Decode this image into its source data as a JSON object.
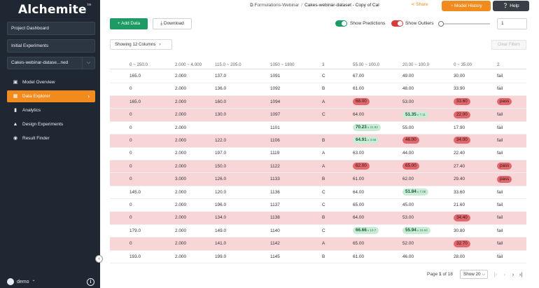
{
  "sidebar": {
    "logo": "Alchemite",
    "logo_mark": "tm",
    "project_dashboard": "Project Dashboard",
    "initial_experiments": "Initial Experiments",
    "dataset_select": "Cakes-webinar-datase...ned",
    "nav": [
      {
        "label": "Model Overview",
        "icon": "model-icon",
        "active": false
      },
      {
        "label": "Data Explorer",
        "icon": "table-icon",
        "active": true
      },
      {
        "label": "Analytics",
        "icon": "bar-chart-icon",
        "active": false
      },
      {
        "label": "Design Experiments",
        "icon": "flask-icon",
        "active": false
      },
      {
        "label": "Result Finder",
        "icon": "target-icon",
        "active": false
      }
    ],
    "user": "demo"
  },
  "header": {
    "breadcrumb_root": "Formulations-Webinar",
    "breadcrumb_current": "Cakes-webinar-dataset - Copy of Cal",
    "share_label": "Share",
    "model_history_label": "Model History",
    "help_label": "Help"
  },
  "toolbar": {
    "add_data_label": "Add Data",
    "download_label": "Download",
    "show_predictions_label": "Show Predictions",
    "show_outliers_label": "Show Outliers",
    "threshold_value": "1",
    "showing_columns_label": "Showing 12 Columns",
    "clear_filters_label": "Clear Filters"
  },
  "colors": {
    "predictions_toggle": "#1e9a64",
    "outliers_toggle": "#d93b3b",
    "accent": "#f28b1e"
  },
  "table": {
    "headers": [
      "0 ~ 250.0",
      "2.000 ~ 4.000",
      "115.0 ~ 205.0",
      "1050 ~ 1800",
      "3",
      "55.00 ~ 100.0",
      "20.00 ~ 100.0",
      "0 ~ 35.00",
      "2"
    ],
    "rows": [
      {
        "hl": false,
        "cells": [
          "165.0",
          "2.000",
          "137.0",
          "1091",
          "C",
          {
            "t": "67.00"
          },
          {
            "t": "49.00"
          },
          {
            "t": "30.00"
          },
          {
            "t": "fail"
          }
        ]
      },
      {
        "hl": false,
        "cells": [
          "0",
          "2.000",
          "136.0",
          "1092",
          "B",
          {
            "t": "61.00"
          },
          {
            "t": "48.00"
          },
          {
            "t": "33.90"
          },
          {
            "t": "fail"
          }
        ]
      },
      {
        "hl": true,
        "cells": [
          "165.0",
          "2.000",
          "160.0",
          "1094",
          "A",
          {
            "t": "68.00",
            "p": "red"
          },
          {
            "t": "53.00"
          },
          {
            "t": "33.60",
            "p": "red"
          },
          {
            "t": "pass",
            "p": "red"
          }
        ]
      },
      {
        "hl": true,
        "cells": [
          "0",
          "2.000",
          "130.0",
          "1097",
          "C",
          {
            "t": "64.00"
          },
          {
            "t": "51.35",
            "p": "green",
            "s": "± 7.11"
          },
          {
            "t": "22.00",
            "p": "red"
          },
          {
            "t": "fail"
          }
        ]
      },
      {
        "hl": false,
        "cells": [
          "0",
          "2.000",
          "",
          "1101",
          "",
          {
            "t": "70.23",
            "p": "green",
            "s": "± 21.92"
          },
          {
            "t": "55.00"
          },
          {
            "t": "17.90"
          },
          {
            "t": "fail"
          }
        ]
      },
      {
        "hl": true,
        "cells": [
          "0",
          "2.000",
          "122.0",
          "1106",
          "B",
          {
            "t": "64.91",
            "p": "green",
            "s": "± 3.58"
          },
          {
            "t": "46.00",
            "p": "red"
          },
          {
            "t": "34.00",
            "p": "red"
          },
          {
            "t": "fail"
          }
        ]
      },
      {
        "hl": false,
        "cells": [
          "0",
          "2.000",
          "197.0",
          "1119",
          "A",
          {
            "t": "63.00"
          },
          {
            "t": "44.00"
          },
          {
            "t": "22.40"
          },
          {
            "t": "fail"
          }
        ]
      },
      {
        "hl": true,
        "cells": [
          "0",
          "2.000",
          "150.0",
          "1122",
          "A",
          {
            "t": "62.00",
            "p": "red"
          },
          {
            "t": "65.00",
            "p": "red"
          },
          {
            "t": "27.40"
          },
          {
            "t": "pass",
            "p": "red"
          }
        ]
      },
      {
        "hl": true,
        "cells": [
          "0",
          "3.000",
          "126.0",
          "1133",
          "B",
          {
            "t": "61.00"
          },
          {
            "t": "62.00"
          },
          {
            "t": "29.40"
          },
          {
            "t": "pass",
            "p": "red"
          }
        ]
      },
      {
        "hl": false,
        "cells": [
          "145.0",
          "2.000",
          "120.0",
          "1136",
          "C",
          {
            "t": "64.00"
          },
          {
            "t": "51.84",
            "p": "green",
            "s": "± 7.08"
          },
          {
            "t": "33.60"
          },
          {
            "t": "fail"
          }
        ]
      },
      {
        "hl": false,
        "cells": [
          "0",
          "2.000",
          "196.0",
          "1137",
          "C",
          {
            "t": "65.00"
          },
          {
            "t": "45.00"
          },
          {
            "t": "21.60"
          },
          {
            "t": "fail"
          }
        ]
      },
      {
        "hl": true,
        "cells": [
          "0",
          "2.000",
          "134.0",
          "1138",
          "B",
          {
            "t": "64.00"
          },
          {
            "t": "53.00"
          },
          {
            "t": "34.40",
            "p": "red"
          },
          {
            "t": "fail"
          }
        ]
      },
      {
        "hl": false,
        "cells": [
          "179.0",
          "2.000",
          "149.0",
          "1140",
          "C",
          {
            "t": "66.66",
            "p": "green",
            "s": "± 13.7"
          },
          {
            "t": "55.94",
            "p": "green",
            "s": "± 15.64"
          },
          {
            "t": "30.80"
          },
          {
            "t": "fail"
          }
        ]
      },
      {
        "hl": true,
        "cells": [
          "0",
          "2.000",
          "141.0",
          "1142",
          "A",
          {
            "t": "65.00"
          },
          {
            "t": "52.00"
          },
          {
            "t": "32.70",
            "p": "red"
          },
          {
            "t": "fail"
          }
        ]
      },
      {
        "hl": false,
        "cells": [
          "193.0",
          "2.000",
          "199.0",
          "1145",
          "B",
          {
            "t": "61.00"
          },
          {
            "t": "46.00"
          },
          {
            "t": "28.00"
          },
          {
            "t": "fail"
          }
        ]
      }
    ]
  },
  "pagination": {
    "page_label": "Page",
    "page_current": "1",
    "page_of": "of 18",
    "page_size_label": "Show 20"
  }
}
